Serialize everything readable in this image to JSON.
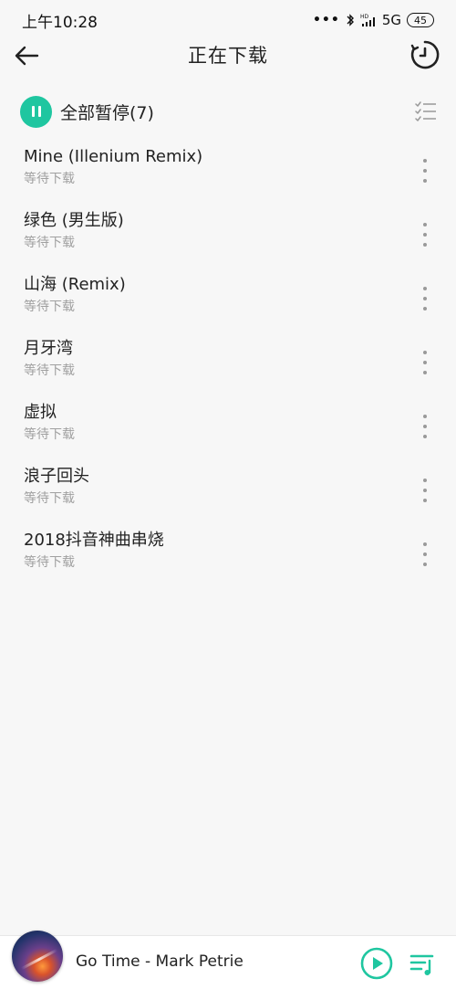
{
  "status_bar": {
    "time": "上午10:28",
    "dots": "•••",
    "network": "5G",
    "battery": "45"
  },
  "header": {
    "title": "正在下载"
  },
  "pause_all": {
    "label": "全部暂停(7)"
  },
  "downloads": [
    {
      "title": "Mine (Illenium Remix)",
      "status": "等待下载"
    },
    {
      "title": "绿色 (男生版)",
      "status": "等待下载"
    },
    {
      "title": "山海 (Remix)",
      "status": "等待下载"
    },
    {
      "title": "月牙湾",
      "status": "等待下载"
    },
    {
      "title": "虚拟",
      "status": "等待下载"
    },
    {
      "title": "浪子回头",
      "status": "等待下载"
    },
    {
      "title": "2018抖音神曲串烧",
      "status": "等待下载"
    }
  ],
  "player": {
    "now_playing": "Go Time - Mark Petrie"
  },
  "colors": {
    "accent": "#1fc6a0",
    "background": "#f7f7f7",
    "secondary_text": "#a0a0a0"
  }
}
